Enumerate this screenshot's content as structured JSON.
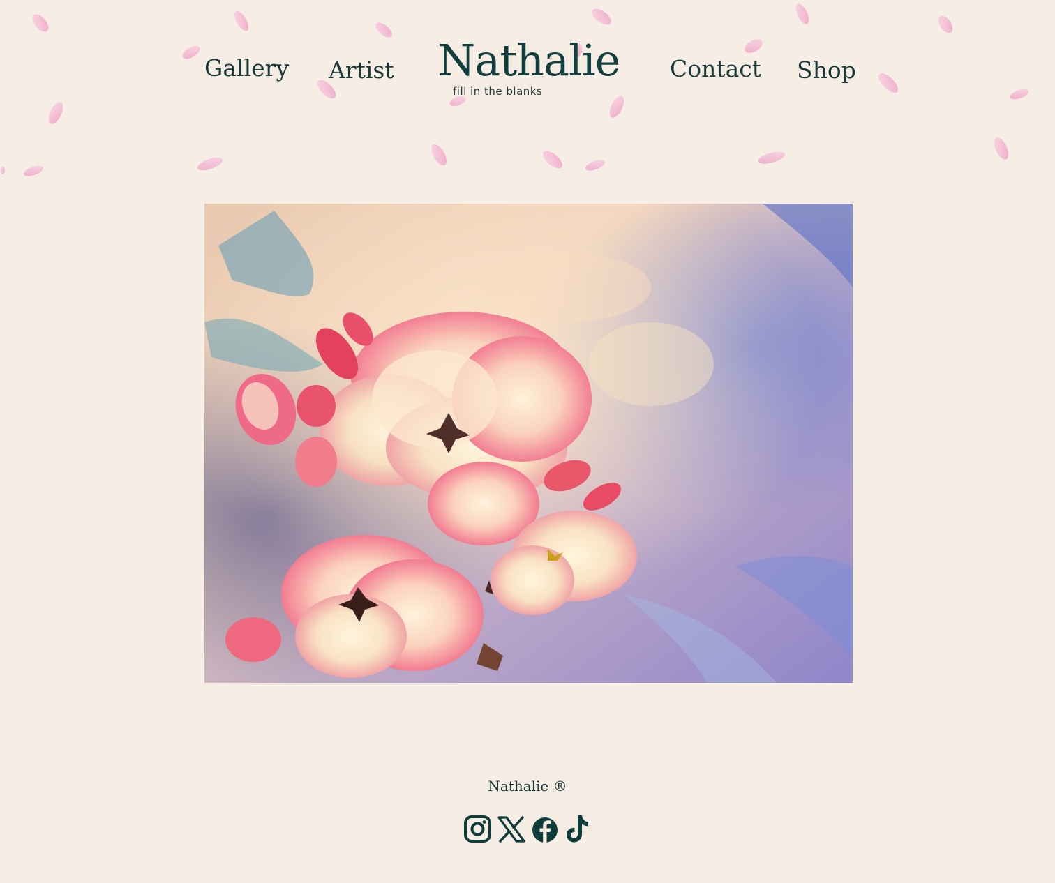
{
  "nav": {
    "left_items": [
      {
        "label": "Gallery"
      },
      {
        "label": "Artist"
      }
    ],
    "right_items": [
      {
        "label": "Contact"
      },
      {
        "label": "Shop"
      }
    ]
  },
  "brand": {
    "name": "Nathalie",
    "tagline": "fill in the blanks"
  },
  "artwork": {
    "icon": "flower-painting"
  },
  "footer": {
    "copyright": "Nathalie ®",
    "social": [
      {
        "icon": "instagram-icon"
      },
      {
        "icon": "x-icon"
      },
      {
        "icon": "facebook-icon"
      },
      {
        "icon": "tiktok-icon"
      }
    ]
  },
  "colors": {
    "background": "#f6ede5",
    "text": "#0f3d3b",
    "petal": "#f2bfd4"
  }
}
